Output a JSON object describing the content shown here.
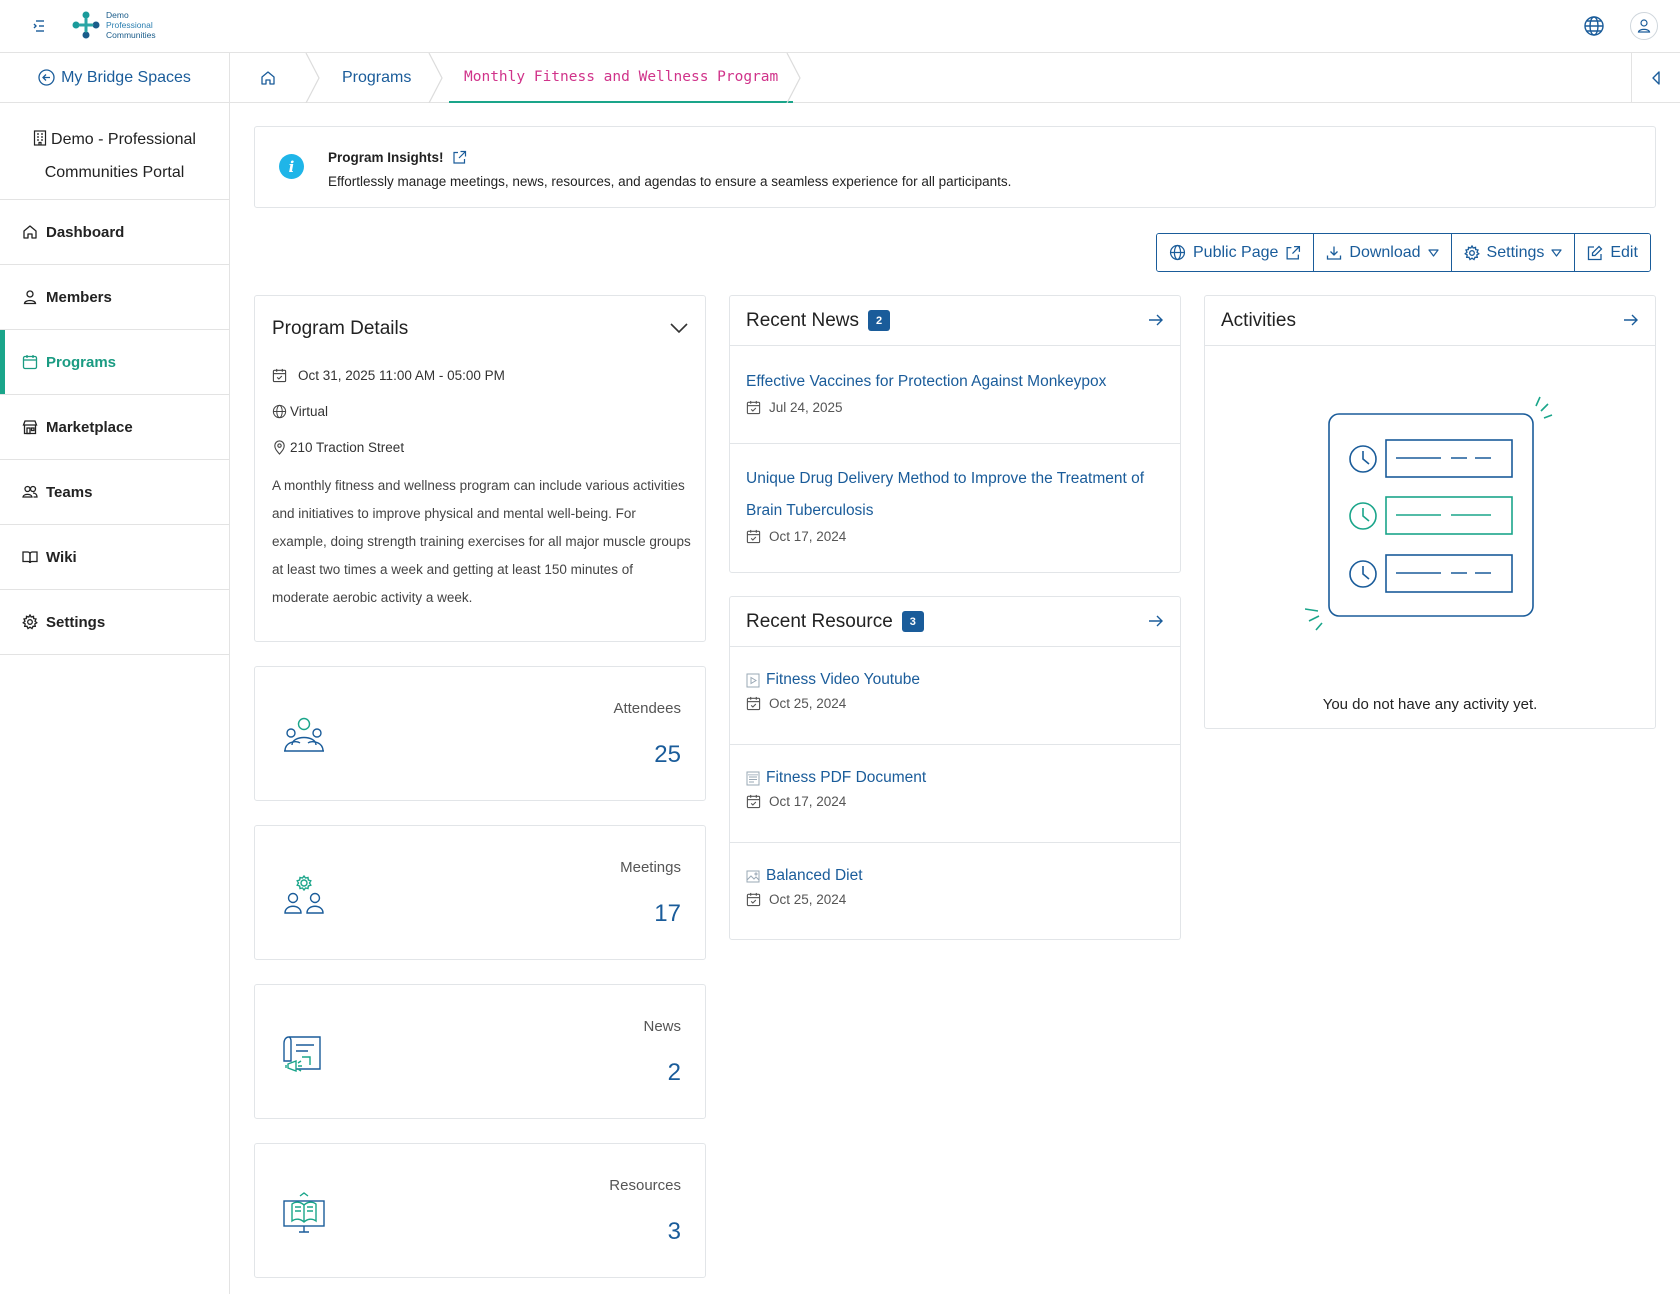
{
  "brand": {
    "line1": "Demo",
    "line2": "Professional",
    "line3": "Communities"
  },
  "sidebar": {
    "back_label": "My Bridge Spaces",
    "portal_line1": "Demo - Professional",
    "portal_line2": "Communities Portal",
    "items": [
      {
        "label": "Dashboard",
        "icon": "home-icon"
      },
      {
        "label": "Members",
        "icon": "user-icon"
      },
      {
        "label": "Programs",
        "icon": "calendar-icon"
      },
      {
        "label": "Marketplace",
        "icon": "store-icon"
      },
      {
        "label": "Teams",
        "icon": "users-icon"
      },
      {
        "label": "Wiki",
        "icon": "book-icon"
      },
      {
        "label": "Settings",
        "icon": "gear-icon"
      }
    ],
    "active": "Programs"
  },
  "breadcrumb": {
    "items": [
      "Programs",
      "Monthly Fitness and Wellness Program"
    ]
  },
  "banner": {
    "title": "Program Insights!",
    "text": "Effortlessly manage meetings, news, resources, and agendas to ensure a seamless experience for all participants."
  },
  "actions": {
    "public_page": "Public Page",
    "download": "Download",
    "settings": "Settings",
    "edit": "Edit"
  },
  "program_details": {
    "title": "Program Details",
    "datetime": "Oct 31, 2025 11:00 AM - 05:00 PM",
    "mode": "Virtual",
    "address": "210 Traction Street",
    "description": "A monthly fitness and wellness program can include various activities and initiatives to improve physical and mental well-being. For example, doing strength training exercises for all major muscle groups at least two times a week and getting at least 150 minutes of moderate aerobic activity a week."
  },
  "stats": [
    {
      "label": "Attendees",
      "value": "25"
    },
    {
      "label": "Meetings",
      "value": "17"
    },
    {
      "label": "News",
      "value": "2"
    },
    {
      "label": "Resources",
      "value": "3"
    }
  ],
  "recent_news": {
    "title": "Recent News",
    "count": "2",
    "items": [
      {
        "title": "Effective Vaccines for Protection Against Monkeypox",
        "date": "Jul 24, 2025"
      },
      {
        "title": "Unique Drug Delivery Method to Improve the Treatment of Brain Tuberculosis",
        "date": "Oct 17, 2024"
      }
    ]
  },
  "recent_resource": {
    "title": "Recent Resource",
    "count": "3",
    "items": [
      {
        "title": "Fitness Video Youtube",
        "date": "Oct 25, 2024",
        "icon": "video-file-icon"
      },
      {
        "title": "Fitness PDF Document",
        "date": "Oct 17, 2024",
        "icon": "pdf-file-icon"
      },
      {
        "title": "Balanced Diet",
        "date": "Oct 25, 2024",
        "icon": "image-file-icon"
      }
    ]
  },
  "activities": {
    "title": "Activities",
    "empty_text": "You do not have any activity yet."
  },
  "colors": {
    "primary": "#1a5c9a",
    "accent": "#1aa58a",
    "current_crumb": "#d0338a",
    "info": "#1fb5e8"
  }
}
